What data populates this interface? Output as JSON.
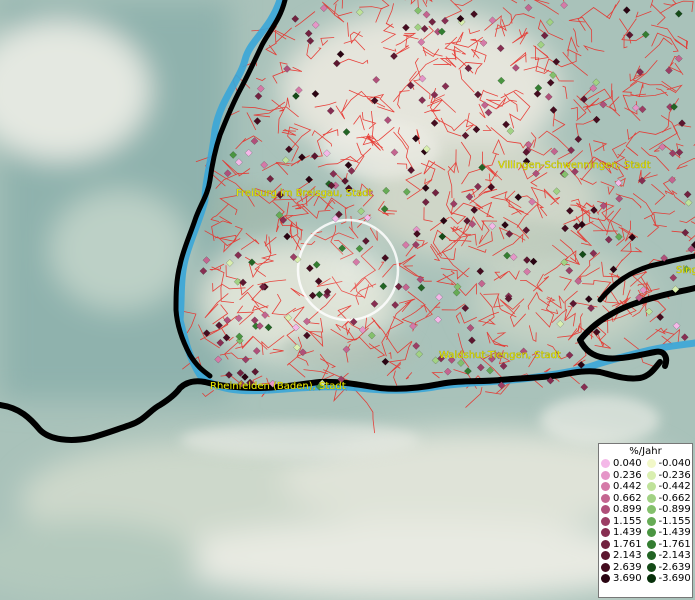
{
  "map": {
    "place_labels": [
      {
        "id": "freiburg",
        "text": "Freiburg im Breisgau, Stadt"
      },
      {
        "id": "villingen",
        "text": "Villingen-Schwenningen, Stadt"
      },
      {
        "id": "waldshut",
        "text": "Waldshut-Tiengen, Stadt"
      },
      {
        "id": "rheinfelden",
        "text": "Rheinfelden (Baden), Stadt"
      },
      {
        "id": "singen",
        "text": "Sing"
      }
    ],
    "colors": {
      "border_line": "#000000",
      "river": "#3aa6d8",
      "admin_boundaries": "#e8302a",
      "highlight_circle": "#ffffff",
      "label_text": "#e6e600"
    }
  },
  "legend": {
    "title": "%/Jahr",
    "positive": [
      {
        "value": "0.040",
        "color": "#f4b8e8"
      },
      {
        "value": "0.236",
        "color": "#e596c8"
      },
      {
        "value": "0.442",
        "color": "#d57aa8"
      },
      {
        "value": "0.662",
        "color": "#c46590"
      },
      {
        "value": "0.899",
        "color": "#b0507a"
      },
      {
        "value": "1.155",
        "color": "#9c3e65"
      },
      {
        "value": "1.439",
        "color": "#872e52"
      },
      {
        "value": "1.761",
        "color": "#722240"
      },
      {
        "value": "2.143",
        "color": "#5c162f"
      },
      {
        "value": "2.639",
        "color": "#440c1f"
      },
      {
        "value": "3.690",
        "color": "#2a0412"
      }
    ],
    "negative": [
      {
        "value": "-0.040",
        "color": "#f2f8c8"
      },
      {
        "value": "-0.236",
        "color": "#d9efb0"
      },
      {
        "value": "-0.442",
        "color": "#bfe29a"
      },
      {
        "value": "-0.662",
        "color": "#a2d284"
      },
      {
        "value": "-0.899",
        "color": "#84c06c"
      },
      {
        "value": "-1.155",
        "color": "#66ab55"
      },
      {
        "value": "-1.439",
        "color": "#4a9541"
      },
      {
        "value": "-1.761",
        "color": "#347d31"
      },
      {
        "value": "-2.143",
        "color": "#226424"
      },
      {
        "value": "-2.639",
        "color": "#144a17"
      },
      {
        "value": "-3.690",
        "color": "#07300a"
      }
    ]
  }
}
